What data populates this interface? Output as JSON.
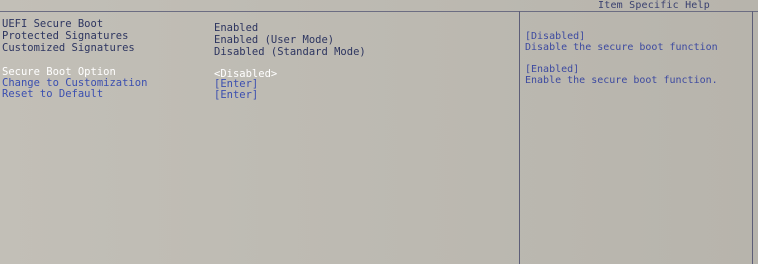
{
  "header": {
    "help_title": "Item Specific Help"
  },
  "settings": [
    {
      "label": "UEFI Secure Boot",
      "value": "Enabled"
    },
    {
      "label": "Protected Signatures",
      "value": "Enabled (User Mode)"
    },
    {
      "label": "Customized Signatures",
      "value": "Disabled (Standard Mode)"
    }
  ],
  "options": [
    {
      "label": "Secure Boot Option",
      "value": "<Disabled>",
      "selected": true
    },
    {
      "label": "Change to Customization",
      "value": "[Enter]"
    },
    {
      "label": "Reset to Default",
      "value": "[Enter]"
    }
  ],
  "help": [
    {
      "title": "[Disabled]",
      "text": "Disable the secure boot function"
    },
    {
      "title": "[Enabled]",
      "text": "Enable the secure boot function."
    }
  ],
  "colors": {
    "background": "#bdbab2",
    "static_text": "#2d3560",
    "option_text": "#3b4fb0",
    "selected_text": "#ffffff",
    "help_text": "#3d4aa0"
  }
}
